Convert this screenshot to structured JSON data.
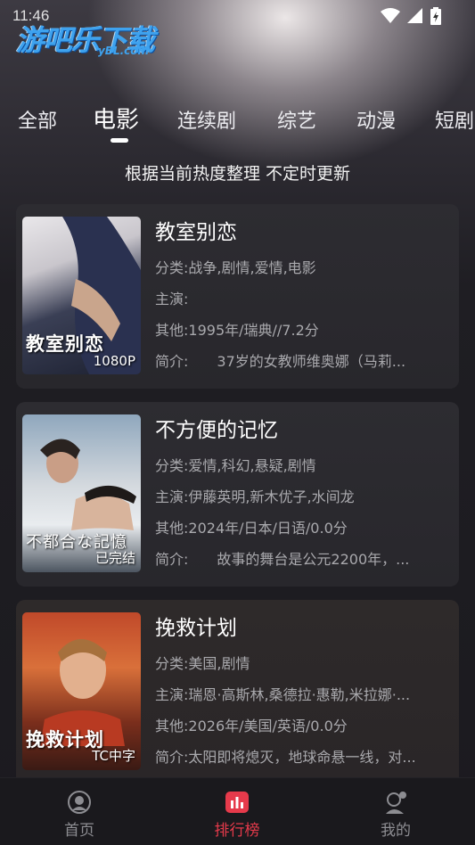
{
  "status": {
    "time": "11:46"
  },
  "logo": {
    "main": "游吧乐下载",
    "sub": "yBL.com"
  },
  "tabs": [
    {
      "label": "全部"
    },
    {
      "label": "电影"
    },
    {
      "label": "连续剧"
    },
    {
      "label": "综艺"
    },
    {
      "label": "动漫"
    },
    {
      "label": "短剧"
    }
  ],
  "active_tab": "电影",
  "subtitle": "根据当前热度整理 不定时更新",
  "movies": [
    {
      "title": "教室别恋",
      "poster_text": "教室别恋",
      "badge": "1080P",
      "category_label": "分类:",
      "category": "战争,剧情,爱情,电影",
      "cast_label": "主演:",
      "cast": "",
      "other_label": "其他:",
      "other": "1995年/瑞典//7.2分",
      "intro_label": "简介:",
      "intro": "37岁的女教师维奥娜（马莉..."
    },
    {
      "title": "不方便的记忆",
      "poster_text": "不都合な記憶",
      "badge": "已完结",
      "category_label": "分类:",
      "category": "爱情,科幻,悬疑,剧情",
      "cast_label": "主演:",
      "cast": "伊藤英明,新木优子,水间龙",
      "other_label": "其他:",
      "other": "2024年/日本/日语/0.0分",
      "intro_label": "简介:",
      "intro": "故事的舞台是公元2200年，..."
    },
    {
      "title": "挽救计划",
      "poster_text": "挽救计划",
      "badge": "TC中字",
      "category_label": "分类:",
      "category": "美国,剧情",
      "cast_label": "主演:",
      "cast": "瑞恩·高斯林,桑德拉·惠勒,米拉娜·...",
      "other_label": "其他:",
      "other": "2026年/美国/英语/0.0分",
      "intro_label": "简介:",
      "intro": "太阳即将熄灭，地球命悬一线，对..."
    }
  ],
  "nav": [
    {
      "label": "首页",
      "icon": "home-icon"
    },
    {
      "label": "排行榜",
      "icon": "ranking-icon"
    },
    {
      "label": "我的",
      "icon": "profile-icon"
    }
  ],
  "colors": {
    "accent": "#e63a4b",
    "logo": "#3ea2ee",
    "background": "#1b1a1f"
  }
}
